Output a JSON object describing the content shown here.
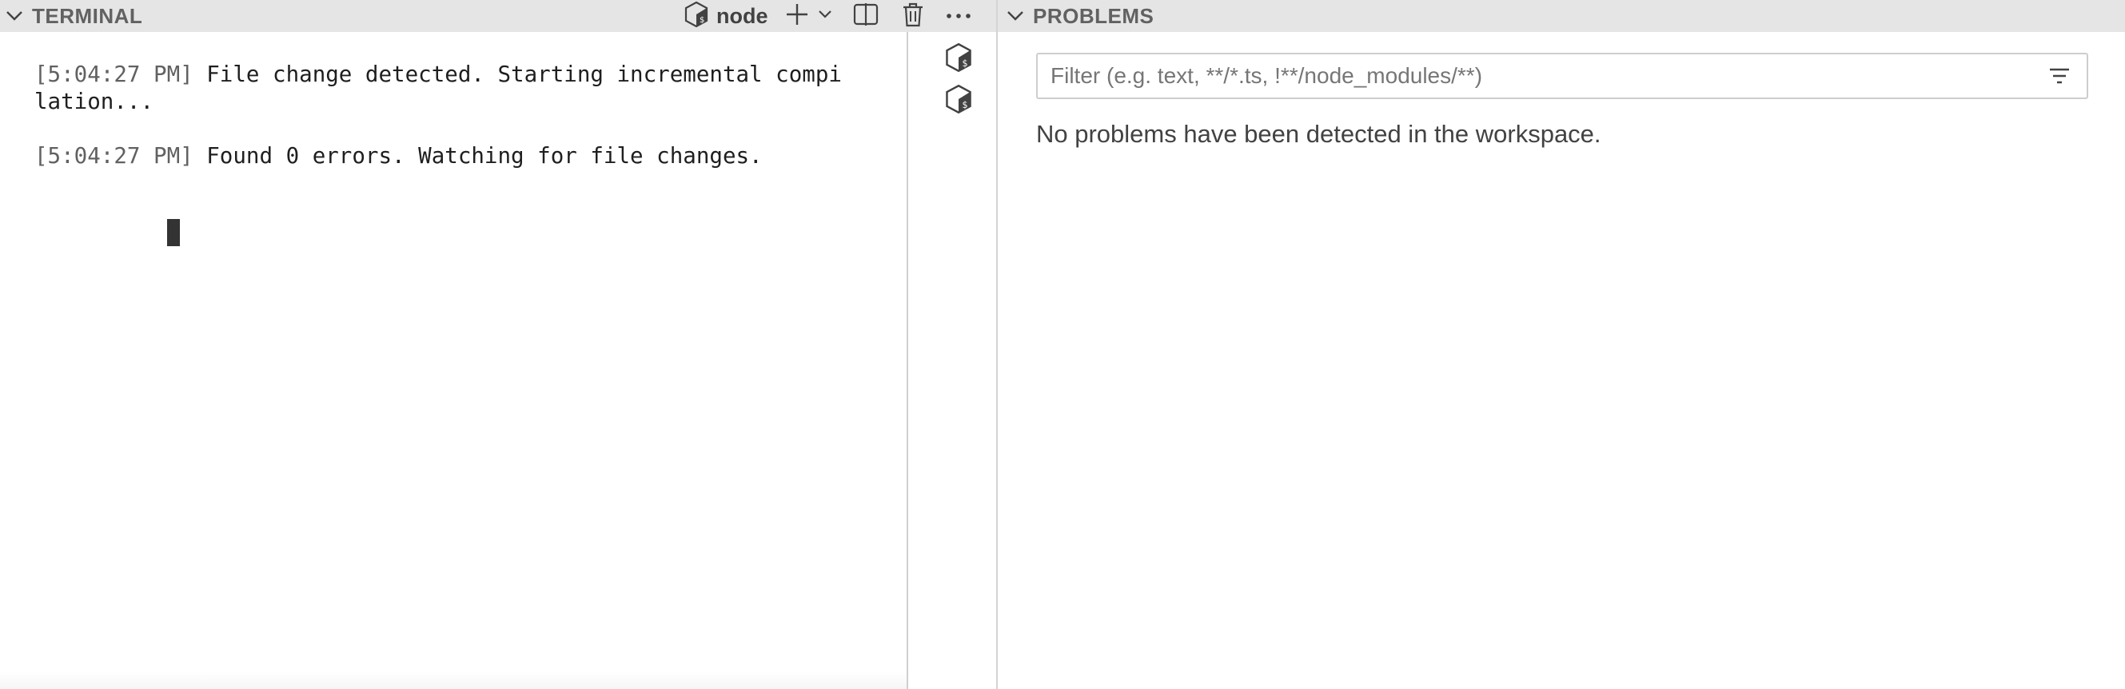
{
  "terminal": {
    "title": "TERMINAL",
    "shell_name": "node",
    "lines": [
      {
        "time": "[5:04:27 PM]",
        "text": " File change detected. Starting incremental compi",
        "wrap": "lation..."
      },
      {
        "time": "[5:04:27 PM]",
        "text": " Found 0 errors. Watching for file changes."
      }
    ],
    "icons": {
      "collapse": "chevron-down-icon",
      "shell": "node-shell-icon",
      "add": "plus-icon",
      "add_dropdown": "chevron-down-icon",
      "split": "split-terminal-icon",
      "kill": "trash-icon",
      "more": "ellipsis-icon"
    },
    "tabs": [
      {
        "name": "terminal-tab-1",
        "icon": "node-shell-icon"
      },
      {
        "name": "terminal-tab-2",
        "icon": "node-shell-icon"
      }
    ]
  },
  "problems": {
    "title": "PROBLEMS",
    "filter_placeholder": "Filter (e.g. text, **/*.ts, !**/node_modules/**)",
    "filter_value": "",
    "empty_message": "No problems have been detected in the workspace.",
    "icons": {
      "collapse": "chevron-down-icon",
      "filter": "filter-icon"
    }
  },
  "colors": {
    "header_bg": "#e5e5e5",
    "title_text": "#616161",
    "divider": "#d4d4d4"
  }
}
